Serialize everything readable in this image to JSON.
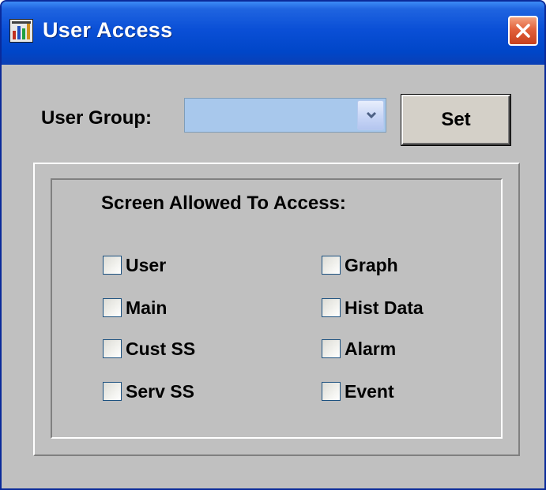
{
  "window": {
    "title": "User Access",
    "icon": "app-chart-icon",
    "close_icon": "close-icon"
  },
  "form": {
    "user_group_label": "User Group:",
    "user_group_value": "",
    "dropdown_icon": "chevron-down-icon",
    "set_label": "Set"
  },
  "access": {
    "title": "Screen Allowed To Access:",
    "left_items": [
      {
        "label": "User",
        "checked": false
      },
      {
        "label": "Main",
        "checked": false
      },
      {
        "label": "Cust SS",
        "checked": false
      },
      {
        "label": "Serv SS",
        "checked": false
      }
    ],
    "right_items": [
      {
        "label": "Graph",
        "checked": false
      },
      {
        "label": "Hist Data",
        "checked": false
      },
      {
        "label": "Alarm",
        "checked": false
      },
      {
        "label": "Event",
        "checked": false
      }
    ]
  },
  "colors": {
    "titlebar": "#0a4fd6",
    "client_bg": "#c0c0c0",
    "close_button": "#e2613b",
    "combo_fill": "#a8c8ec"
  }
}
